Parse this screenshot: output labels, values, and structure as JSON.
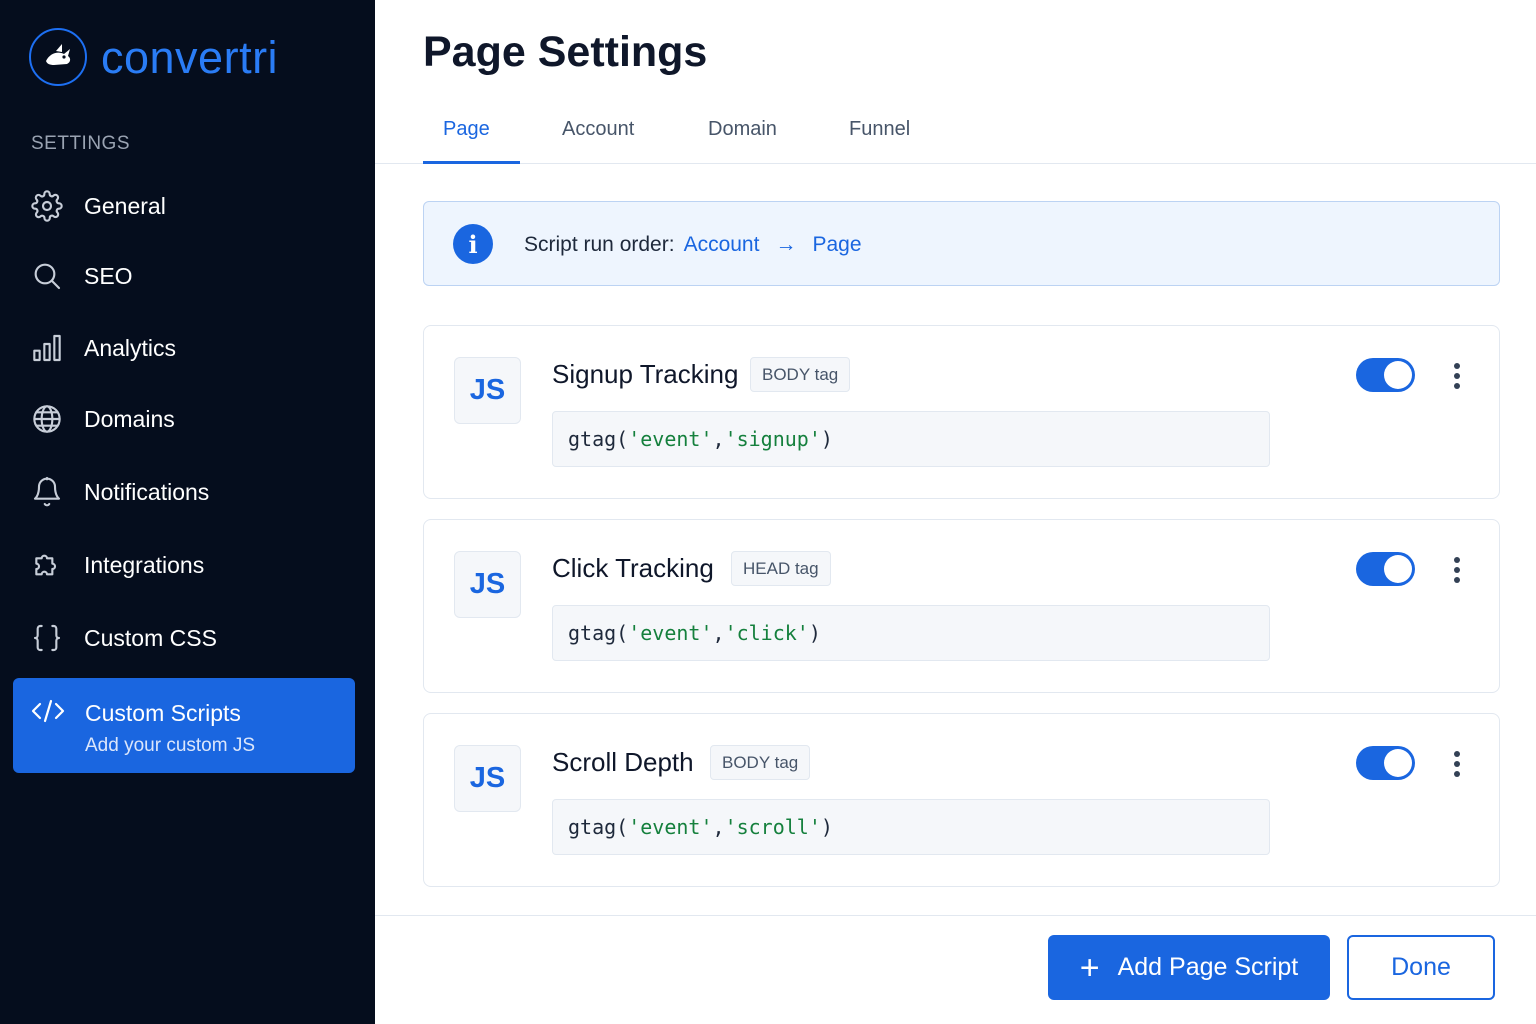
{
  "app": {
    "brand": "convertri",
    "logo_icon": "rabbit-logo-icon"
  },
  "sidebar": {
    "section_label": "SETTINGS",
    "items": [
      {
        "label": "General",
        "icon": "gear-icon"
      },
      {
        "label": "SEO",
        "icon": "search-icon"
      },
      {
        "label": "Analytics",
        "icon": "bar-chart-icon"
      },
      {
        "label": "Domains",
        "icon": "globe-icon"
      },
      {
        "label": "Notifications",
        "icon": "bell-icon"
      },
      {
        "label": "Integrations",
        "icon": "puzzle-icon"
      },
      {
        "label": "Custom CSS",
        "icon": "curly-braces-icon"
      }
    ],
    "active_item": {
      "label": "Custom Scripts",
      "sublabel": "Add your custom JS",
      "icon": "code-icon"
    }
  },
  "main": {
    "title": "Page Settings",
    "tabs": [
      {
        "label": "Page",
        "active": true
      },
      {
        "label": "Account",
        "active": false
      },
      {
        "label": "Domain",
        "active": false
      },
      {
        "label": "Funnel",
        "active": false
      }
    ],
    "info": {
      "icon": "info-icon",
      "prefix": "Script run order:",
      "first": "Account",
      "arrow": "→",
      "second": "Page"
    },
    "scripts": [
      {
        "badge": "JS",
        "name": "Signup Tracking",
        "tag": "BODY tag",
        "code_fn": "gtag(",
        "code_arg1": "'event'",
        "code_sep": ",",
        "code_arg2": "'signup'",
        "code_end": ")",
        "enabled": true
      },
      {
        "badge": "JS",
        "name": "Click Tracking",
        "tag": "HEAD tag",
        "code_fn": "gtag(",
        "code_arg1": "'event'",
        "code_sep": ",",
        "code_arg2": "'click'",
        "code_end": ")",
        "enabled": true
      },
      {
        "badge": "JS",
        "name": "Scroll Depth",
        "tag": "BODY tag",
        "code_fn": "gtag(",
        "code_arg1": "'event'",
        "code_sep": ",",
        "code_arg2": "'scroll'",
        "code_end": ")",
        "enabled": true
      }
    ],
    "footer": {
      "add_label": "Add Page Script",
      "add_icon": "plus-icon",
      "done_label": "Done"
    }
  },
  "colors": {
    "accent": "#1a66e0",
    "sidebar_bg": "#050d1d",
    "code_string": "#15803d"
  }
}
